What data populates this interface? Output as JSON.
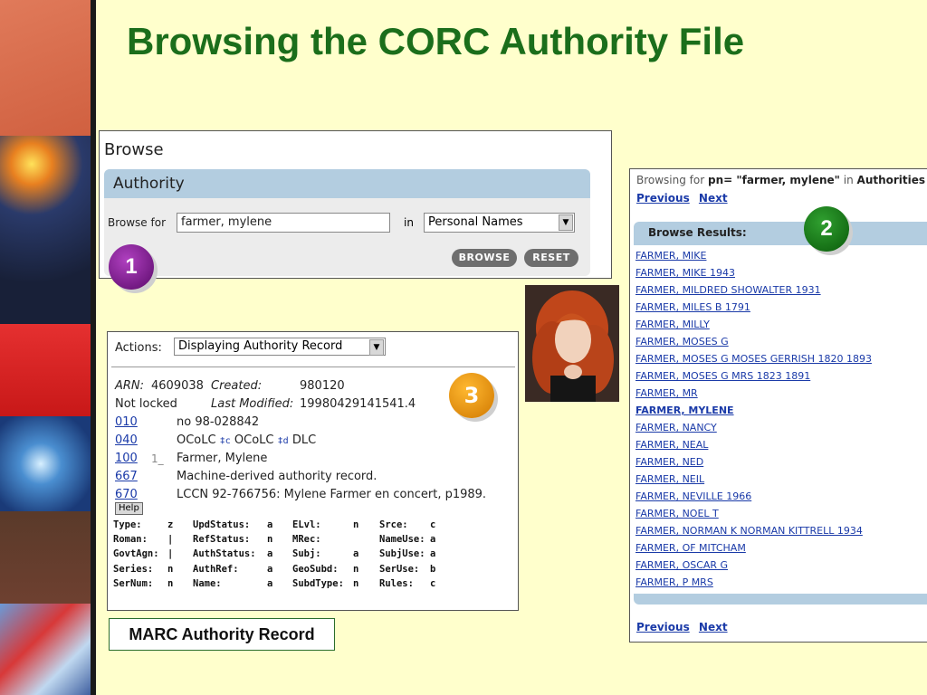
{
  "slide": {
    "title": "Browsing the CORC Authority File"
  },
  "badges": [
    "1",
    "2",
    "3"
  ],
  "browse": {
    "heading": "Browse",
    "section": "Authority",
    "browse_for_label": "Browse for",
    "query": "farmer, mylene",
    "in_label": "in",
    "index": "Personal Names",
    "browse_button": "BROWSE",
    "reset_button": "RESET"
  },
  "results": {
    "browsing_for_label": "Browsing for",
    "query_expr": "pn= \"farmer, mylene\"",
    "in_label": "in",
    "scope": "Authorities",
    "previous": "Previous",
    "next": "Next",
    "header": "Browse Results:",
    "items": [
      "FARMER, MIKE",
      "FARMER, MIKE 1943",
      "FARMER, MILDRED SHOWALTER 1931",
      "FARMER, MILES B 1791",
      "FARMER, MILLY",
      "FARMER, MOSES G",
      "FARMER, MOSES G MOSES GERRISH 1820 1893",
      "FARMER, MOSES G MRS 1823 1891",
      "FARMER, MR",
      "FARMER, MYLENE",
      "FARMER, NANCY",
      "FARMER, NEAL",
      "FARMER, NED",
      "FARMER, NEIL",
      "FARMER, NEVILLE 1966",
      "FARMER, NOEL T",
      "FARMER, NORMAN K NORMAN KITTRELL 1934",
      "FARMER, OF MITCHAM",
      "FARMER, OSCAR G",
      "FARMER, P MRS"
    ],
    "selected_index": 9
  },
  "record": {
    "actions_label": "Actions:",
    "action": "Displaying Authority Record",
    "arn_label": "ARN:",
    "arn": "4609038",
    "created_label": "Created:",
    "created": "980120",
    "lock": "Not locked",
    "modified_label": "Last Modified:",
    "modified": "19980429141541.4",
    "help": "Help",
    "fields": {
      "f010": {
        "tag": "010",
        "value": "no 98-028842"
      },
      "f040": {
        "tag": "040",
        "a": "OCoLC",
        "sub_c": "‡c",
        "c": "OCoLC",
        "sub_d": "‡d",
        "d": "DLC"
      },
      "f100": {
        "tag": "100",
        "ind": "1_",
        "value": "Farmer, Mylene"
      },
      "f667": {
        "tag": "667",
        "value": "Machine-derived authority record."
      },
      "f670": {
        "tag": "670",
        "value": "LCCN 92-766756: Mylene Farmer en concert, p1989."
      }
    },
    "fixed": [
      [
        "Type:",
        "z",
        "UpdStatus:",
        "a",
        "ELvl:",
        "n",
        "Srce:",
        "c"
      ],
      [
        "Roman:",
        "|",
        "RefStatus:",
        "n",
        "MRec:",
        "",
        "NameUse:",
        "a"
      ],
      [
        "GovtAgn:",
        "|",
        "AuthStatus:",
        "a",
        "Subj:",
        "a",
        "SubjUse:",
        "a"
      ],
      [
        "Series:",
        "n",
        "AuthRef:",
        "a",
        "GeoSubd:",
        "n",
        "SerUse:",
        "b"
      ],
      [
        "SerNum:",
        "n",
        "Name:",
        "a",
        "SubdType:",
        "n",
        "Rules:",
        "c"
      ]
    ]
  },
  "caption": "MARC Authority Record",
  "colors": {
    "title_green": "#1b6e1b",
    "link_blue": "#1a3aa8",
    "bar_blue": "#b3cde0",
    "background": "#ffffcc"
  }
}
